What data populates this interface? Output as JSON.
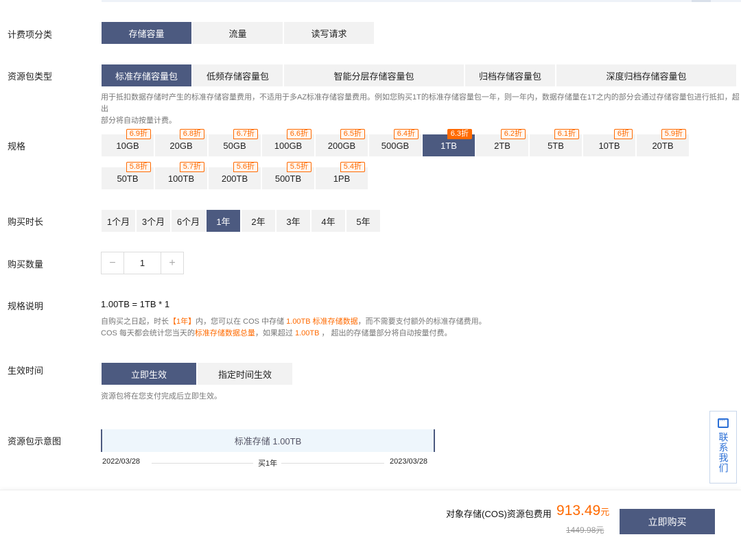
{
  "labels": {
    "billing_item": "计费项分类",
    "package_type": "资源包类型",
    "spec": "规格",
    "duration": "购买时长",
    "quantity": "购买数量",
    "spec_desc": "规格说明",
    "effective_time": "生效时间",
    "diagram": "资源包示意图"
  },
  "billing_items": [
    "存储容量",
    "流量",
    "读写请求"
  ],
  "package_types": [
    "标准存储容量包",
    "低频存储容量包",
    "智能分层存储容量包",
    "归档存储容量包",
    "深度归档存储容量包"
  ],
  "package_desc_line1": "用于抵扣数据存储时产生的标准存储容量费用，不适用于多AZ标准存储容量费用。例如您购买1T的标准存储容量包一年，则一年内，数据存储量在1T之内的部分会通过存储容量包进行抵扣，超出",
  "package_desc_line2": "部分将自动按量计费。",
  "specs": [
    {
      "size": "10GB",
      "discount": "6.9折"
    },
    {
      "size": "20GB",
      "discount": "6.8折"
    },
    {
      "size": "50GB",
      "discount": "6.7折"
    },
    {
      "size": "100GB",
      "discount": "6.6折"
    },
    {
      "size": "200GB",
      "discount": "6.5折"
    },
    {
      "size": "500GB",
      "discount": "6.4折"
    },
    {
      "size": "1TB",
      "discount": "6.3折"
    },
    {
      "size": "2TB",
      "discount": "6.2折"
    },
    {
      "size": "5TB",
      "discount": "6.1折"
    },
    {
      "size": "10TB",
      "discount": "6折"
    },
    {
      "size": "20TB",
      "discount": "5.9折"
    },
    {
      "size": "50TB",
      "discount": "5.8折"
    },
    {
      "size": "100TB",
      "discount": "5.7折"
    },
    {
      "size": "200TB",
      "discount": "5.6折"
    },
    {
      "size": "500TB",
      "discount": "5.5折"
    },
    {
      "size": "1PB",
      "discount": "5.4折"
    }
  ],
  "durations": [
    "1个月",
    "3个月",
    "6个月",
    "1年",
    "2年",
    "3年",
    "4年",
    "5年"
  ],
  "quantity": {
    "minus": "−",
    "value": "1",
    "plus": "+"
  },
  "spec_formula": "1.00TB = 1TB * 1",
  "spec_note": {
    "p1": "自购买之日起，时长",
    "p2": "【1年】",
    "p3": "内，您可以在 COS 中存储",
    "p4": "1.00TB 标准存储数据",
    "p5": "，而不需要支付额外的标准存储费用。",
    "p6": "COS 每天都会统计您当天的",
    "p7": "标准存储数据总量",
    "p8": "，如果超过",
    "p9": "1.00TB",
    "p10": "， 超出的存储量部分将自动按量付费。"
  },
  "effective_options": [
    "立即生效",
    "指定时间生效"
  ],
  "effective_desc": "资源包将在您支付完成后立即生效。",
  "diagram": {
    "bar_text": "标准存储 1.00TB",
    "start": "2022/03/28",
    "middle": "买1年",
    "end": "2023/03/28"
  },
  "contact": "联系我们",
  "footer": {
    "fee_label": "对象存储(COS)资源包费用",
    "price": "913.49",
    "currency": "元",
    "original": "1449.98元",
    "buy": "立即购买"
  },
  "colors": {
    "primary": "#4c5a80",
    "accent": "#ff6a00"
  }
}
